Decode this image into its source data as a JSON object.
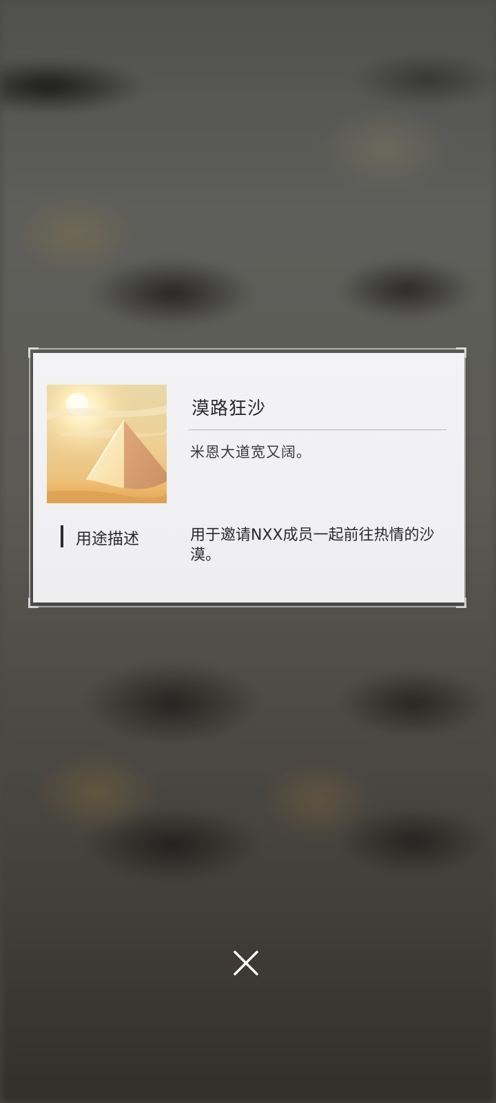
{
  "item": {
    "name": "漠路狂沙",
    "flavor_text": "米恩大道宽又阔。",
    "description_label": "用途描述",
    "description_text": "用于邀请NXX成员一起前往热情的沙漠。"
  },
  "icons": {
    "close": "close-icon",
    "item_image": "pyramid-desert-image"
  },
  "colors": {
    "card_background": "#f0f0f3",
    "text_primary": "#2a2a2e",
    "close_icon": "#ffffff"
  }
}
